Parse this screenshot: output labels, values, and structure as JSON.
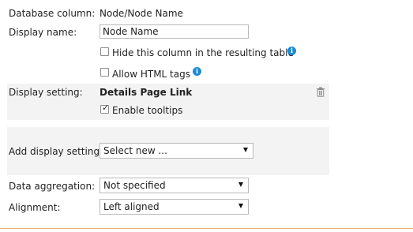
{
  "form": {
    "database_column": {
      "label": "Database column:",
      "value": "Node/Node Name"
    },
    "display_name": {
      "label": "Display name:",
      "value": "Node Name"
    },
    "hide_column": {
      "label": "Hide this column in the resulting table",
      "checked": false,
      "info_icon": "info-icon"
    },
    "allow_html": {
      "label": "Allow HTML tags",
      "checked": false,
      "info_icon": "info-icon"
    },
    "display_setting": {
      "label": "Display setting:",
      "value": "Details Page Link",
      "delete_icon": "trash-icon",
      "enable_tooltips": {
        "label": "Enable tooltips",
        "checked": true
      }
    },
    "add_display_settings": {
      "label": "Add display settings:",
      "selected": "Select new ..."
    },
    "data_aggregation": {
      "label": "Data aggregation:",
      "selected": "Not specified"
    },
    "alignment": {
      "label": "Alignment:",
      "selected": "Left aligned"
    }
  },
  "colors": {
    "panel_background": "#f3f3f3",
    "info_icon": "#1b8ad3",
    "footer_line": "#f0b464"
  }
}
